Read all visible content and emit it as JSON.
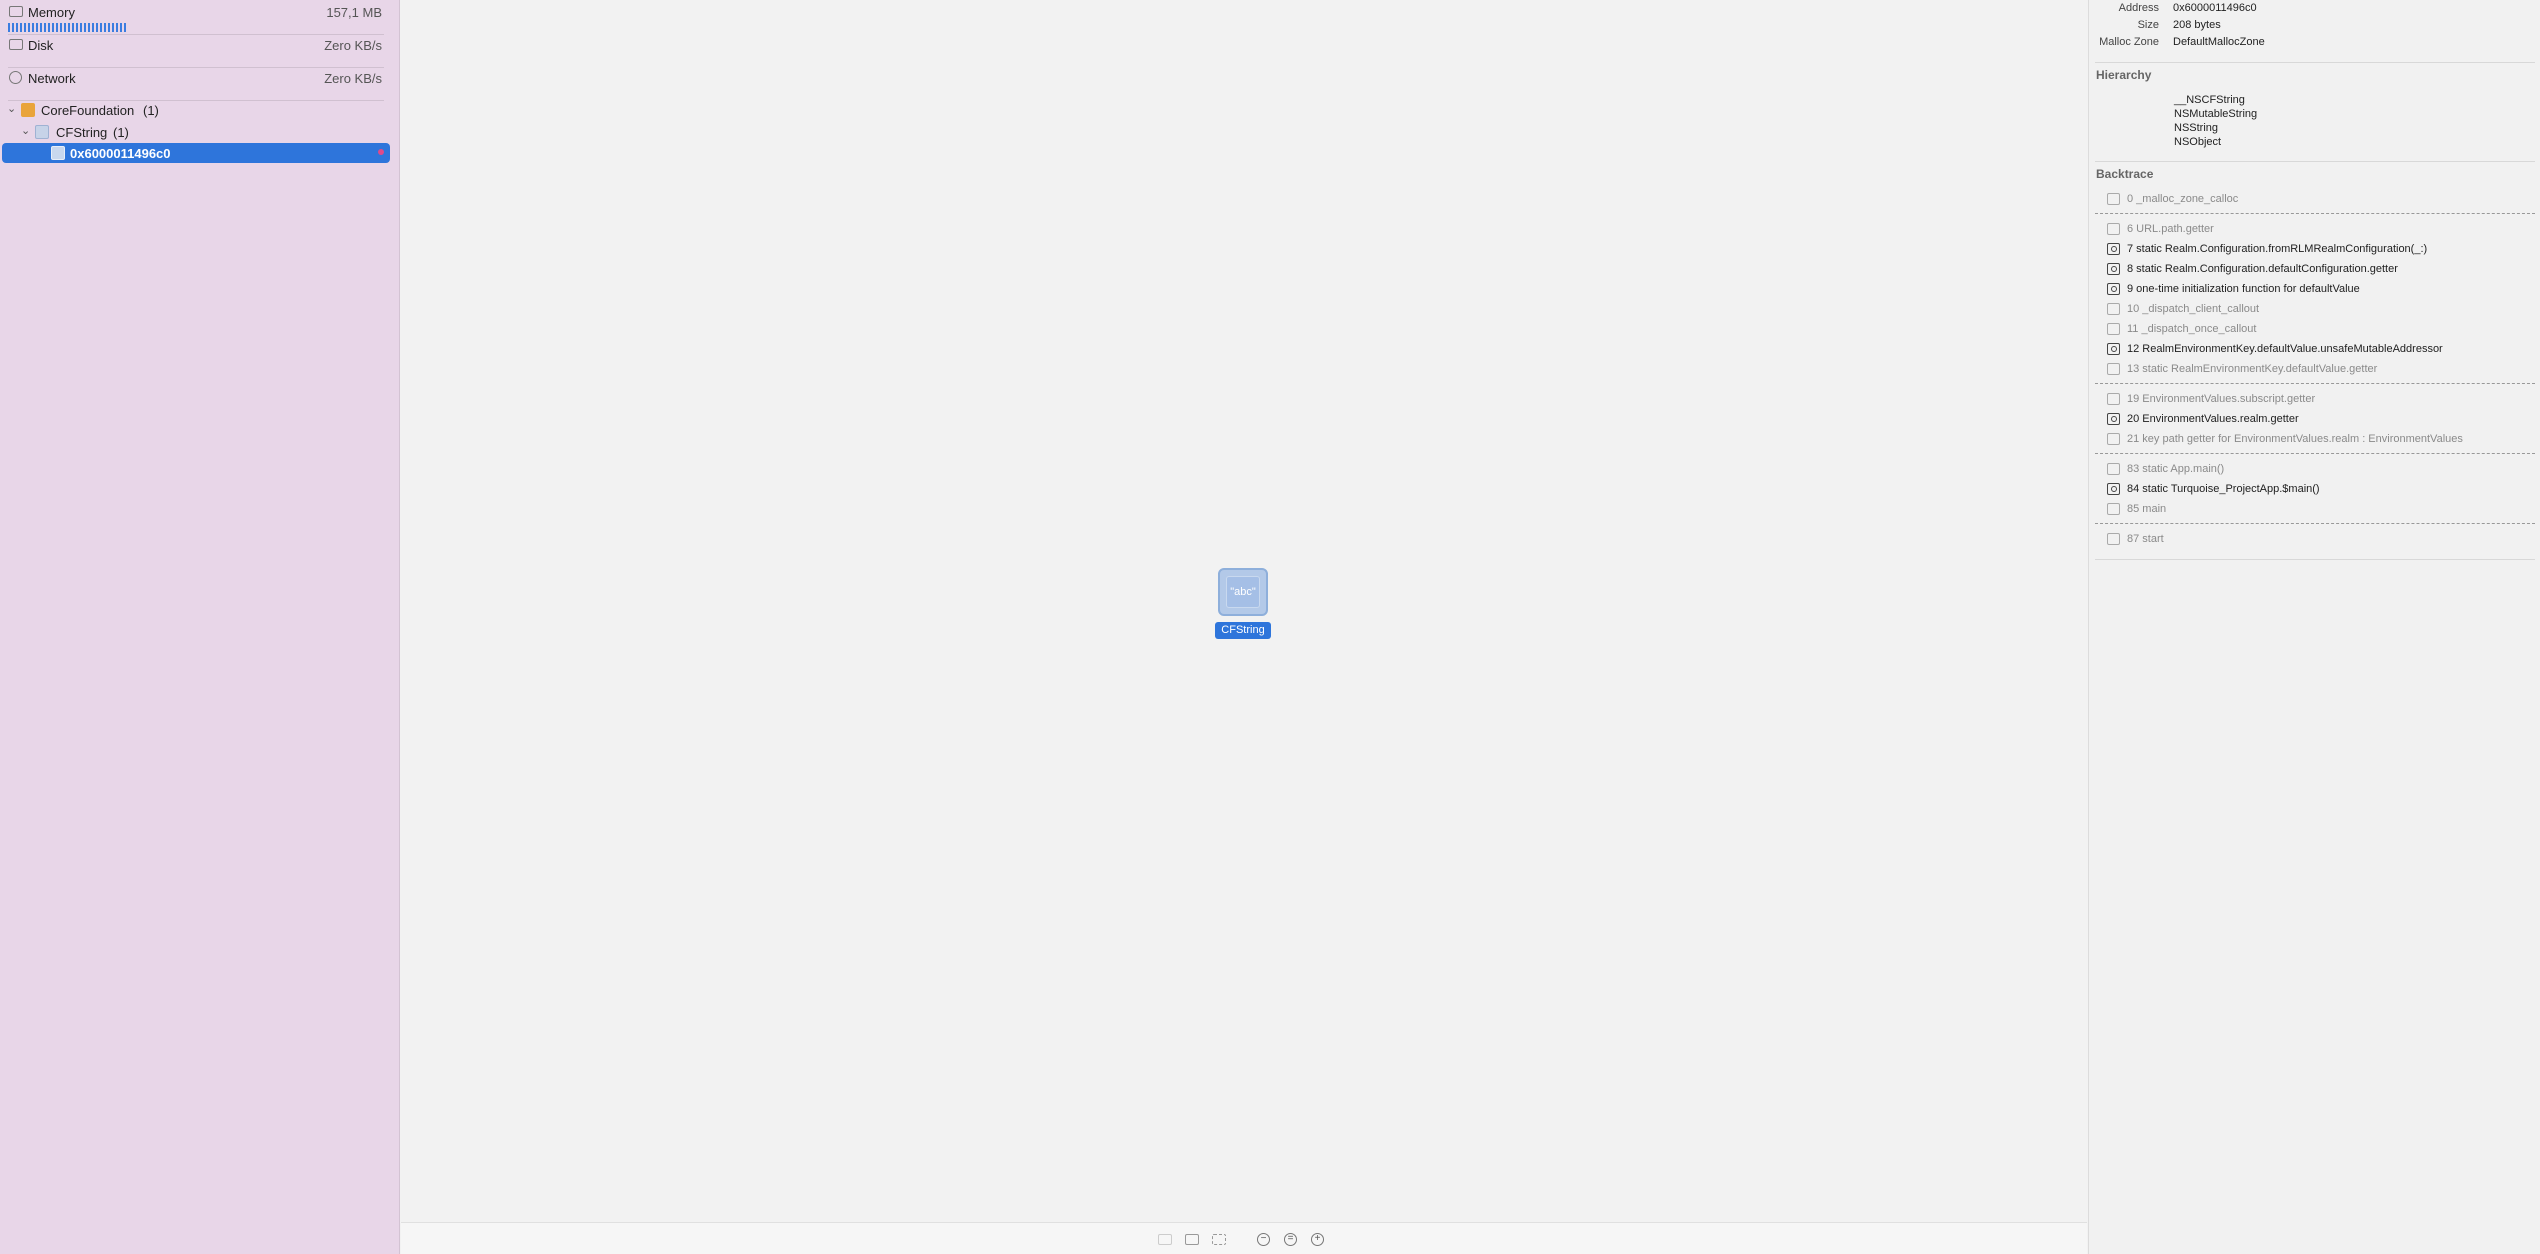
{
  "gauges": {
    "memory": {
      "label": "Memory",
      "value": "157,1 MB"
    },
    "disk": {
      "label": "Disk",
      "value": "Zero KB/s"
    },
    "network": {
      "label": "Network",
      "value": "Zero KB/s"
    }
  },
  "tree": {
    "root": {
      "label": "CoreFoundation",
      "count": "(1)"
    },
    "child": {
      "label": "CFString",
      "count": "(1)"
    },
    "leaf": {
      "label": "0x6000011496c0"
    }
  },
  "graph": {
    "node_glyph": "\"abc\"",
    "node_label": "CFString"
  },
  "inspector": {
    "address": {
      "key": "Address",
      "value": "0x6000011496c0"
    },
    "size": {
      "key": "Size",
      "value": "208 bytes"
    },
    "malloc_zone": {
      "key": "Malloc Zone",
      "value": "DefaultMallocZone"
    },
    "hierarchy_title": "Hierarchy",
    "hierarchy": [
      "__NSCFString",
      "NSMutableString",
      "NSString",
      "NSObject"
    ],
    "backtrace_title": "Backtrace",
    "backtrace": [
      "0 _malloc_zone_calloc",
      "6 URL.path.getter",
      "7 static Realm.Configuration.fromRLMRealmConfiguration(_:)",
      "8 static Realm.Configuration.defaultConfiguration.getter",
      "9 one-time initialization function for defaultValue",
      "10 _dispatch_client_callout",
      "11 _dispatch_once_callout",
      "12 RealmEnvironmentKey.defaultValue.unsafeMutableAddressor",
      "13 static RealmEnvironmentKey.defaultValue.getter",
      "19 EnvironmentValues.subscript.getter",
      "20 EnvironmentValues.realm.getter",
      "21 key path getter for EnvironmentValues.realm : EnvironmentValues",
      "83 static App.main()",
      "84 static Turquoise_ProjectApp.$main()",
      "85 main",
      "87 start"
    ]
  },
  "colors": {
    "sidebar_bg": "#e8d6e8",
    "selection": "#2e75db",
    "canvas_bg": "#f2f2f2"
  }
}
